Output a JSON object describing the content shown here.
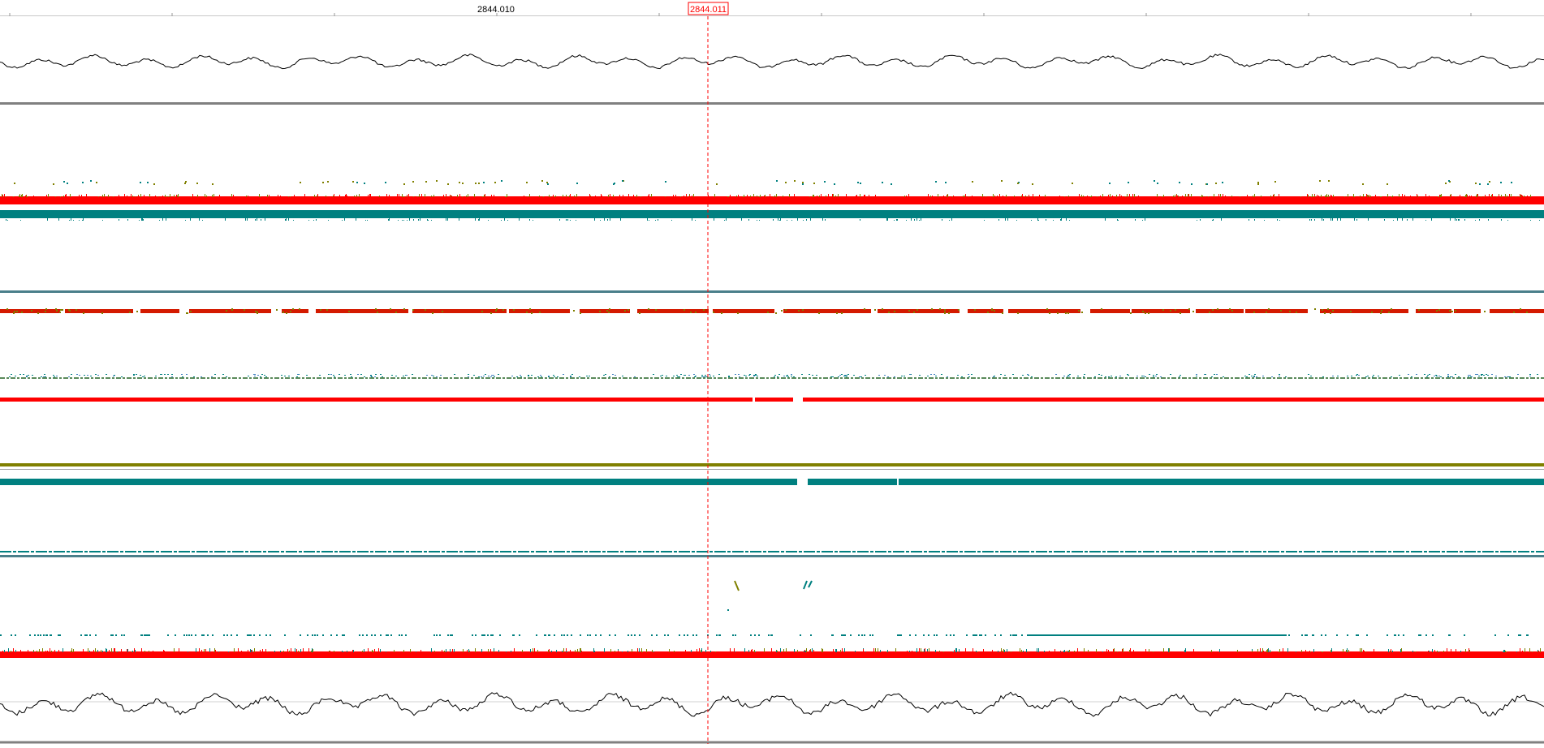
{
  "ruler": {
    "tick_label": "2844.010",
    "cursor_label": "2844.011"
  },
  "colors": {
    "background": "#ffffff",
    "cursor": "#ff0000",
    "trace": "#000000",
    "red_track": "#ff0000",
    "teal_track": "#008080",
    "olive_track": "#808000",
    "separator": "#808080"
  },
  "tracks": [
    {
      "id": "waveform-top",
      "style": "waveform"
    },
    {
      "id": "red-band-1",
      "style": "red-band"
    },
    {
      "id": "teal-band-1",
      "style": "teal-band"
    },
    {
      "id": "red-dashed-1",
      "style": "red-dashed"
    },
    {
      "id": "teal-scatter-1",
      "style": "teal-scatter"
    },
    {
      "id": "red-line-1",
      "style": "red-line"
    },
    {
      "id": "olive-line-1",
      "style": "olive-line"
    },
    {
      "id": "teal-band-2",
      "style": "teal-band"
    },
    {
      "id": "teal-line-1",
      "style": "teal-line"
    },
    {
      "id": "red-band-2",
      "style": "red-band"
    },
    {
      "id": "waveform-bottom",
      "style": "waveform"
    }
  ]
}
